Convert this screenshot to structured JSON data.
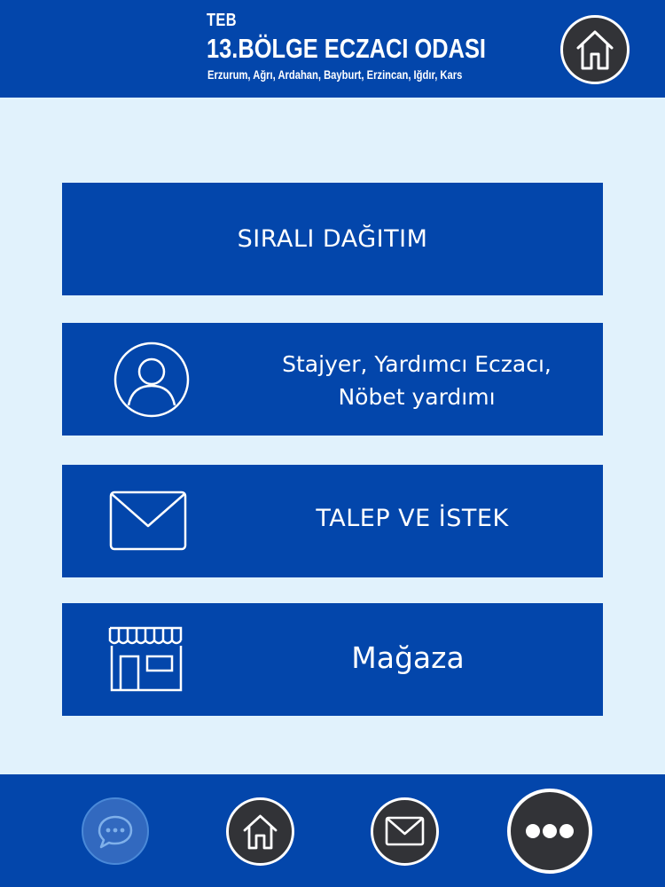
{
  "header": {
    "org_short": "TEB",
    "title": "13.BÖLGE ECZACI ODASI",
    "subtitle": "Erzurum, Ağrı, Ardahan, Bayburt, Erzincan, Iğdır, Kars",
    "home_icon": "home-icon"
  },
  "menu": {
    "items": [
      {
        "label": "SIRALI DAĞITIM",
        "icon": ""
      },
      {
        "label_line1": "Stajyer, Yardımcı Eczacı,",
        "label_line2": "Nöbet yardımı",
        "icon": "user-icon"
      },
      {
        "label": "TALEP VE İSTEK",
        "icon": "envelope-icon"
      },
      {
        "label": "Mağaza",
        "icon": "store-icon"
      }
    ]
  },
  "footer": {
    "buttons": [
      {
        "icon": "chat-icon",
        "state": "inactive"
      },
      {
        "icon": "home-icon"
      },
      {
        "icon": "envelope-icon"
      },
      {
        "icon": "more-icon",
        "state": "active"
      }
    ]
  },
  "colors": {
    "primary": "#0346ab",
    "background": "#e1f2fc",
    "button_dark": "#323337",
    "text": "#ffffff"
  }
}
